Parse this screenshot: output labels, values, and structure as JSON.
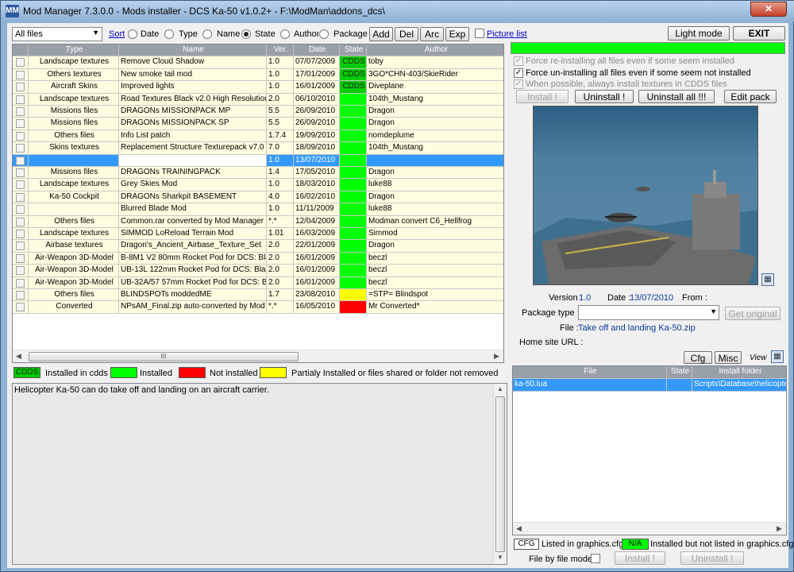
{
  "window": {
    "title": "Mod Manager 7.3.0.0 - Mods installer - DCS Ka-50 v1.0.2+ - F:\\ModMan\\addons_dcs\\",
    "close": "✕",
    "icon": "MM"
  },
  "toolbar": {
    "filter_value": "All files",
    "sort_label": "Sort",
    "sort_options": [
      "Date",
      "Type",
      "Name",
      "State",
      "Author",
      "Package"
    ],
    "sort_selected": "State",
    "buttons": [
      "Add",
      "Del",
      "Arc",
      "Exp"
    ],
    "picture_list": "Picture list",
    "light_mode": "Light mode",
    "exit": "EXIT"
  },
  "grid": {
    "headers": [
      "",
      "Type",
      "Name",
      "Ver.",
      "Date",
      "State",
      "Author"
    ],
    "rows": [
      {
        "type": "Landscape textures",
        "name": "Remove Cloud Shadow",
        "ver": "1.0",
        "date": "07/07/2009",
        "state": "CDDS",
        "author": "toby"
      },
      {
        "type": "Others textures",
        "name": "New smoke tail mod",
        "ver": "1.0",
        "date": "17/01/2009",
        "state": "CDDS",
        "author": "3GO*CHN-403/SkieRider"
      },
      {
        "type": "Aircraft Skins",
        "name": "Improved lights",
        "ver": "1.0",
        "date": "16/01/2009",
        "state": "CDDS",
        "author": "Diveplane"
      },
      {
        "type": "Landscape textures",
        "name": "Road Textures Black v2.0 High Resolution",
        "ver": "2.0",
        "date": "06/10/2010",
        "state": "green",
        "author": "104th_Mustang"
      },
      {
        "type": "Missions files",
        "name": "DRAGONs MISSIONPACK MP",
        "ver": "5.5",
        "date": "26/09/2010",
        "state": "green",
        "author": "Dragon"
      },
      {
        "type": "Missions files",
        "name": "DRAGONs MISSIONPACK SP",
        "ver": "5.5",
        "date": "26/09/2010",
        "state": "green",
        "author": "Dragon"
      },
      {
        "type": "Others files",
        "name": "Info List patch",
        "ver": "1.7.4",
        "date": "19/09/2010",
        "state": "green",
        "author": "nomdeplume"
      },
      {
        "type": "Skins textures",
        "name": "Replacement Structure Texturepack v7.0",
        "ver": "7.0",
        "date": "18/09/2010",
        "state": "green",
        "author": "104th_Mustang"
      },
      {
        "type": "",
        "name": "",
        "ver": "1.0",
        "date": "13/07/2010",
        "state": "green",
        "author": "",
        "selected": true
      },
      {
        "type": "Missions files",
        "name": "DRAGONs TRAININGPACK",
        "ver": "1.4",
        "date": "17/05/2010",
        "state": "green",
        "author": "Dragon"
      },
      {
        "type": "Landscape textures",
        "name": "Grey Skies Mod",
        "ver": "1.0",
        "date": "18/03/2010",
        "state": "green",
        "author": "luke88"
      },
      {
        "type": "Ka-50 Cockpit",
        "name": "DRAGONs Sharkpit BASEMENT",
        "ver": "4.0",
        "date": "16/02/2010",
        "state": "green",
        "author": "Dragon"
      },
      {
        "type": "",
        "name": "Blurred Blade Mod",
        "ver": "1.0",
        "date": "11/11/2009",
        "state": "green",
        "author": "luke88"
      },
      {
        "type": "Others files",
        "name": "Common.rar converted by Mod Manager",
        "ver": "*.*",
        "date": "12/04/2009",
        "state": "green",
        "author": "Modman convert C6_Hellfrog"
      },
      {
        "type": "Landscape textures",
        "name": "SIMMOD LoReload Terrain Mod",
        "ver": "1.01",
        "date": "16/03/2009",
        "state": "green",
        "author": "Simmod"
      },
      {
        "type": "Airbase textures",
        "name": "Dragon's_Ancient_Airbase_Texture_Set",
        "ver": "2.0",
        "date": "22/01/2009",
        "state": "green",
        "author": "Dragon"
      },
      {
        "type": "Air-Weapon 3D-Model",
        "name": "B-8M1 V2 80mm Rocket Pod for DCS: Black Shark",
        "ver": "2.0",
        "date": "16/01/2009",
        "state": "green",
        "author": "beczl"
      },
      {
        "type": "Air-Weapon 3D-Model",
        "name": "UB-13L 122mm Rocket Pod for DCS: Black Shark",
        "ver": "2.0",
        "date": "16/01/2009",
        "state": "green",
        "author": "beczl"
      },
      {
        "type": "Air-Weapon 3D-Model",
        "name": "UB-32A/57 57mm Rocket Pod for DCS: Black Shark",
        "ver": "2.0",
        "date": "16/01/2009",
        "state": "green",
        "author": "beczl"
      },
      {
        "type": "Others files",
        "name": "BLINDSPOTs moddedME",
        "ver": "1.7",
        "date": "23/08/2010",
        "state": "yellow",
        "author": "=STP= Blindspot"
      },
      {
        "type": "Converted",
        "name": "NPsAM_Final.zip auto-converted by Mod Manager",
        "ver": "*.*",
        "date": "16/05/2010",
        "state": "red",
        "author": "Mr Converted*"
      }
    ]
  },
  "legend": {
    "cdds_chip": "CDDS",
    "cdds": "Installed in cdds",
    "installed": "Installed",
    "not_installed": "Not installed",
    "partial": "Partialy Installed or files shared or folder not removed"
  },
  "description": "Helicopter Ka-50 can do take off and landing on an aircraft carrier.",
  "options": {
    "force_reinstall": "Force re-installing all files even if some seem installed",
    "force_uninstall": "Force un-installing all files even if some seem not installed",
    "cdds": "When possible, always install textures in CDDS files",
    "install": "Install !",
    "uninstall": "Uninstall !",
    "uninstall_all": "Uninstall all !!!",
    "edit_pack": "Edit pack"
  },
  "details": {
    "version_label": "Version :",
    "version": "1.0",
    "date_label": "Date :",
    "date": "13/07/2010",
    "from_label": "From :",
    "package_type_label": "Package type :",
    "package_type": "",
    "get_original": "Get original",
    "file_label": "File :",
    "file": "Take off and landing Ka-50.zip",
    "home_label": "Home site URL :",
    "cfg": "Cfg",
    "misc": "Misc",
    "view": "View"
  },
  "files": {
    "headers": [
      "File",
      "State",
      "Install folder"
    ],
    "rows": [
      {
        "file": "ka-50.lua",
        "state": "",
        "folder": "Scripts\\Database\\helicopters"
      }
    ]
  },
  "bottom": {
    "cfg_chip": "CFG",
    "cfg_text": "Listed in graphics.cfg",
    "na_chip": "N/A",
    "na_text": "Installed but not listed in graphics.cfg",
    "file_by_file": "File by file mode",
    "install": "Install !",
    "uninstall": "Uninstall !"
  },
  "colors": {
    "installed": "#00ff00",
    "not_installed": "#ff0000",
    "partial": "#ffff00",
    "cdds": "#00cc00",
    "selection": "#3399ff"
  }
}
